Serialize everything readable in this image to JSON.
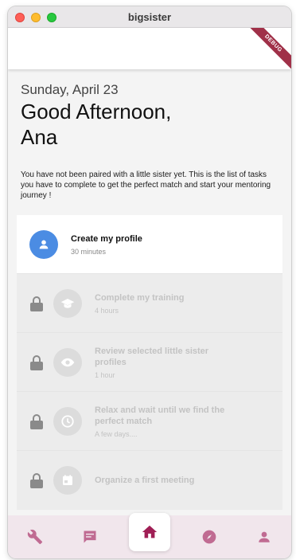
{
  "window": {
    "title": "bigsister"
  },
  "debug_banner": "DEBUG",
  "header": {
    "date": "Sunday, April 23",
    "greeting_line1": "Good Afternoon,",
    "greeting_line2": "Ana"
  },
  "intro": "You have not been paired with a little sister yet. This is the list of tasks you have to complete to get the perfect match and start your mentoring journey !",
  "tasks": [
    {
      "title": "Create my profile",
      "duration": "30 minutes",
      "icon": "person-icon",
      "state": "active"
    },
    {
      "title": "Complete my training",
      "duration": "4 hours",
      "icon": "graduation-cap-icon",
      "state": "locked"
    },
    {
      "title": "Review selected little sister profiles",
      "duration": "1 hour",
      "icon": "eye-icon",
      "state": "locked"
    },
    {
      "title": "Relax and wait until we find the perfect match",
      "duration": "A few days....",
      "icon": "clock-icon",
      "state": "locked"
    },
    {
      "title": "Organize a first meeting",
      "duration": "",
      "icon": "calendar-icon",
      "state": "locked"
    }
  ],
  "bottom_nav": [
    {
      "icon": "wrench-icon"
    },
    {
      "icon": "chat-icon"
    },
    {
      "icon": "home-icon",
      "selected": true
    },
    {
      "icon": "compass-icon"
    },
    {
      "icon": "person-icon"
    }
  ],
  "colors": {
    "accent": "#a01f55",
    "nav_icon": "#c06b92",
    "profile_circle": "#4b8ce3",
    "nav_background": "#f1e6ec"
  }
}
